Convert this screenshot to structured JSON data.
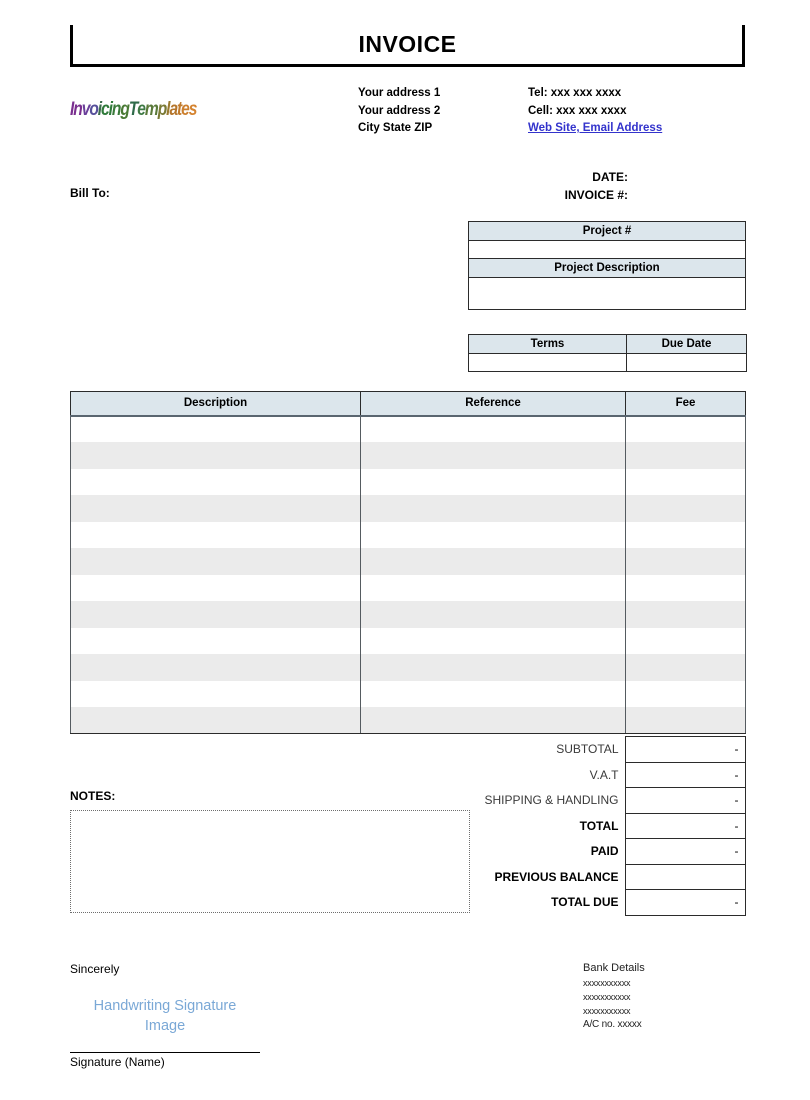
{
  "document": {
    "title": "INVOICE"
  },
  "logo": {
    "text": "InvoicingTemplates",
    "letters": [
      {
        "ch": "I",
        "color": "#7a2f8f"
      },
      {
        "ch": "n",
        "color": "#7a2f8f"
      },
      {
        "ch": "v",
        "color": "#6a3f9a"
      },
      {
        "ch": "o",
        "color": "#57509b"
      },
      {
        "ch": "i",
        "color": "#3a6b4a"
      },
      {
        "ch": "c",
        "color": "#2f7a3a"
      },
      {
        "ch": "i",
        "color": "#2f7a3a"
      },
      {
        "ch": "n",
        "color": "#3a7a3a"
      },
      {
        "ch": "g",
        "color": "#4a7a35"
      },
      {
        "ch": "T",
        "color": "#2f6b4a"
      },
      {
        "ch": "e",
        "color": "#3f7a45"
      },
      {
        "ch": "m",
        "color": "#5a7a3a"
      },
      {
        "ch": "p",
        "color": "#7a7a35"
      },
      {
        "ch": "l",
        "color": "#9a7a30"
      },
      {
        "ch": "a",
        "color": "#b5762c"
      },
      {
        "ch": "t",
        "color": "#c07a2c"
      },
      {
        "ch": "e",
        "color": "#cc7f2e"
      },
      {
        "ch": "s",
        "color": "#d4832f"
      }
    ]
  },
  "seller": {
    "address_lines": [
      "Your address 1",
      "Your address 2",
      "City State ZIP"
    ],
    "tel": "Tel: xxx xxx xxxx",
    "cell": "Cell: xxx xxx xxxx",
    "web": "Web Site, Email Address"
  },
  "bill_to": {
    "label": "Bill To:"
  },
  "meta": {
    "date_label": "DATE:",
    "invoice_no_label": "INVOICE #:"
  },
  "project_table": {
    "number_header": "Project #",
    "number_value": "",
    "description_header": "Project Description",
    "description_value": ""
  },
  "terms_table": {
    "terms_header": "Terms",
    "due_date_header": "Due Date",
    "terms_value": "",
    "due_date_value": ""
  },
  "items_table": {
    "columns": [
      "Description",
      "Reference",
      "Fee"
    ],
    "rows": [
      {
        "description": "",
        "reference": "",
        "fee": ""
      },
      {
        "description": "",
        "reference": "",
        "fee": ""
      },
      {
        "description": "",
        "reference": "",
        "fee": ""
      },
      {
        "description": "",
        "reference": "",
        "fee": ""
      },
      {
        "description": "",
        "reference": "",
        "fee": ""
      },
      {
        "description": "",
        "reference": "",
        "fee": ""
      },
      {
        "description": "",
        "reference": "",
        "fee": ""
      },
      {
        "description": "",
        "reference": "",
        "fee": ""
      },
      {
        "description": "",
        "reference": "",
        "fee": ""
      },
      {
        "description": "",
        "reference": "",
        "fee": ""
      },
      {
        "description": "",
        "reference": "",
        "fee": ""
      },
      {
        "description": "",
        "reference": "",
        "fee": ""
      }
    ]
  },
  "totals": [
    {
      "label": "SUBTOTAL",
      "value": "-",
      "bold": false
    },
    {
      "label": "V.A.T",
      "value": "-",
      "bold": false
    },
    {
      "label": "SHIPPING & HANDLING",
      "value": "-",
      "bold": false
    },
    {
      "label": "TOTAL",
      "value": "-",
      "bold": true
    },
    {
      "label": "PAID",
      "value": "-",
      "bold": true
    },
    {
      "label": "PREVIOUS BALANCE",
      "value": "",
      "bold": true
    },
    {
      "label": "TOTAL DUE",
      "value": "-",
      "bold": true
    }
  ],
  "notes": {
    "label": "NOTES:",
    "value": ""
  },
  "footer": {
    "sincerely": "Sincerely",
    "signature_image_line1": "Handwriting Signature",
    "signature_image_line2": "Image",
    "signature_name": "Signature (Name)"
  },
  "bank": {
    "title": "Bank Details",
    "line1": "xxxxxxxxxxx",
    "line2": "xxxxxxxxxxx",
    "line3": "xxxxxxxxxxx",
    "account": "A/C no. xxxxx"
  },
  "colors": {
    "header_fill": "#dce6ec",
    "row_alt_fill": "#ebebeb",
    "link": "#3333cc",
    "signature_blue": "#7aa8d6",
    "border": "#2b2b2b"
  }
}
